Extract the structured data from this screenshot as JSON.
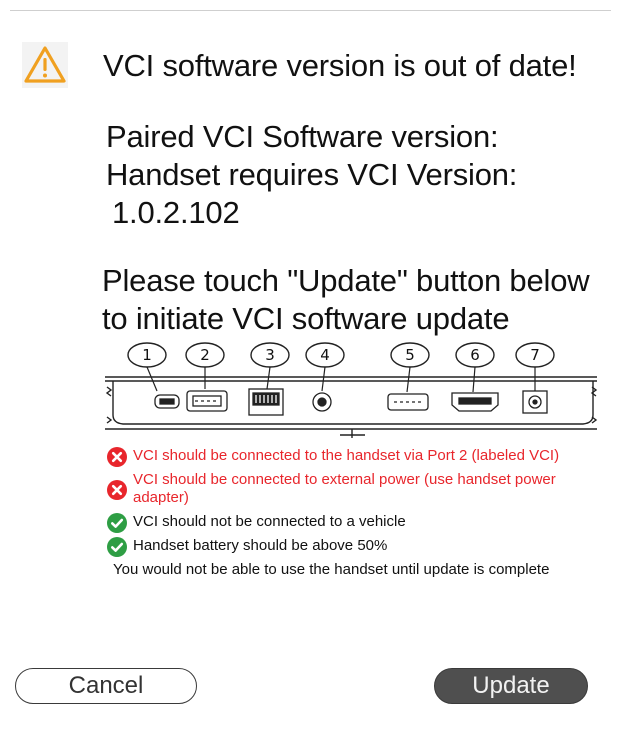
{
  "dialog": {
    "title": "VCI software version is out of date!",
    "paired_version_label": "Paired VCI Software version:",
    "required_version_label": "Handset requires VCI Version:",
    "required_version_value": "1.0.2.102",
    "instruction_line1": "Please touch \"Update\" button below",
    "instruction_line2": "to initiate VCI software update"
  },
  "ports": {
    "labels": [
      "1",
      "2",
      "3",
      "4",
      "5",
      "6",
      "7"
    ]
  },
  "checklist": [
    {
      "status": "fail",
      "icon": "error-x-icon",
      "text": "VCI should be connected to the handset via Port 2 (labeled VCI)"
    },
    {
      "status": "fail",
      "icon": "error-x-icon",
      "text": "VCI should be connected to external power (use handset power adapter)"
    },
    {
      "status": "pass",
      "icon": "check-icon",
      "text": "VCI should not be connected to a vehicle"
    },
    {
      "status": "pass",
      "icon": "check-icon",
      "text": "Handset battery should be above 50%"
    }
  ],
  "notice": "You would not be able to use the handset until update is complete",
  "buttons": {
    "cancel_label": "Cancel",
    "update_label": "Update"
  },
  "colors": {
    "warning": "#f0a020",
    "error": "#e8262c",
    "success": "#2e9e44",
    "update_button": "#4f4f4f"
  }
}
